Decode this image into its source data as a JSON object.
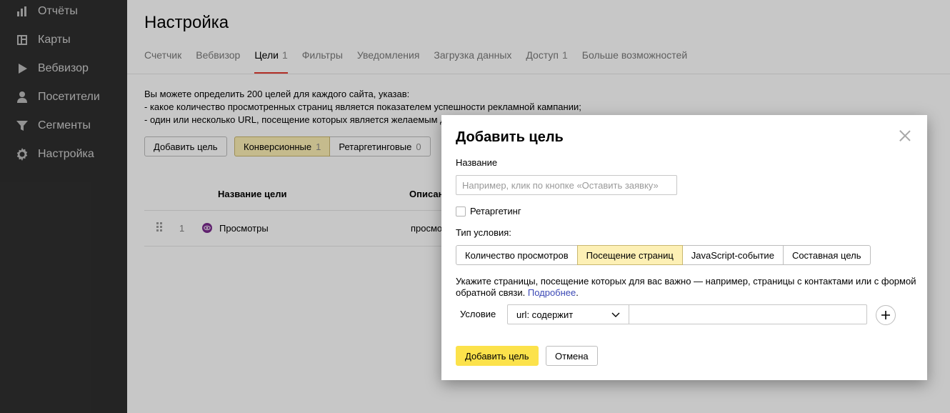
{
  "sidebar": {
    "items": [
      {
        "label": "Отчёты",
        "icon": "bar-chart-icon"
      },
      {
        "label": "Карты",
        "icon": "map-layout-icon"
      },
      {
        "label": "Вебвизор",
        "icon": "play-icon"
      },
      {
        "label": "Посетители",
        "icon": "person-icon"
      },
      {
        "label": "Сегменты",
        "icon": "funnel-icon"
      },
      {
        "label": "Настройка",
        "icon": "gear-icon"
      }
    ]
  },
  "page": {
    "title": "Настройка",
    "tabs": [
      {
        "label": "Счетчик",
        "count": ""
      },
      {
        "label": "Вебвизор",
        "count": ""
      },
      {
        "label": "Цели",
        "count": "1"
      },
      {
        "label": "Фильтры",
        "count": ""
      },
      {
        "label": "Уведомления",
        "count": ""
      },
      {
        "label": "Загрузка данных",
        "count": ""
      },
      {
        "label": "Доступ",
        "count": "1"
      },
      {
        "label": "Больше возможностей",
        "count": ""
      }
    ],
    "description": {
      "line1": "Вы можете определить 200 целей для каждого сайта, указав:",
      "line2": "-  какое количество просмотренных страниц является показателем успешности рекламной кампании;",
      "line3": "-  один или несколько URL, посещение которых является желаемым д"
    },
    "add_goal_label": "Добавить цель",
    "filters": {
      "conversion_label": "Конверсионные",
      "conversion_count": "1",
      "retargeting_label": "Ретаргетинговые",
      "retargeting_count": "0"
    },
    "table": {
      "col_name": "Название цели",
      "col_desc": "Описан",
      "rows": [
        {
          "num": "1",
          "name": "Просмотры",
          "desc": "просмо"
        }
      ]
    }
  },
  "modal": {
    "title": "Добавить цель",
    "name_label": "Название",
    "name_placeholder": "Например, клик по кнопке «Оставить заявку»",
    "retargeting_label": "Ретаргетинг",
    "condition_type_label": "Тип условия:",
    "condition_types": [
      "Количество просмотров",
      "Посещение страниц",
      "JavaScript-событие",
      "Составная цель"
    ],
    "hint_text": "Укажите страницы, посещение которых для вас важно — например, страницы с контактами или с формой обратной связи. ",
    "hint_link": "Подробнее",
    "hint_end": ".",
    "condition_label": "Условие",
    "condition_select": "url: содержит",
    "submit_label": "Добавить цель",
    "cancel_label": "Отмена"
  },
  "colors": {
    "sidebar_bg": "#2f2f2f",
    "accent_yellow": "#fce24b",
    "selected_segment": "#fdf0b5",
    "active_tab_underline": "#e43d32",
    "link": "#3b48b5",
    "goal_icon": "#7b2c8f"
  }
}
